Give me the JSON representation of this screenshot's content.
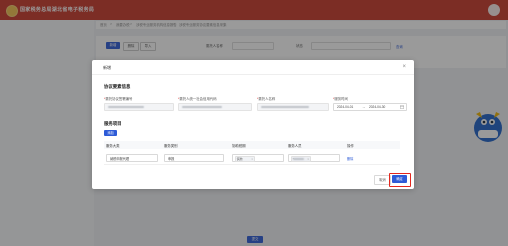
{
  "portal": {
    "title": "国家税务总局湖北省电子税务局"
  },
  "breadcrumb": {
    "home": "首页",
    "sep1": ">",
    "level1": "我要办税",
    "sep2": ">",
    "level2": "涉税专业服务机构信息报告",
    "sep3": ">",
    "current": "涉税专业服务协议要素信息采集"
  },
  "toolbar": {
    "add_label": "新增",
    "delete_label": "删除",
    "import_label": "导入"
  },
  "filters": {
    "client_label": "委托人名称",
    "status_label": "状态",
    "query_label": "查询"
  },
  "bottom": {
    "submit_label": "提交"
  },
  "modal": {
    "title": "新增",
    "close_label": "×",
    "section_agreement": "协议要素信息",
    "fields": {
      "agreement_no_label": "委托协议签署编号",
      "client_id_label": "委托人统一社会信用代码",
      "client_name_label": "委托人名称",
      "period_label": "服务时间",
      "required_mark": "*",
      "period_start": "2024-04-01",
      "period_sep": "→",
      "period_end": "2024-04-30"
    },
    "section_items": "服务项目",
    "add_item_label": "添加",
    "table": {
      "headers": [
        "服务大类",
        "服务类别",
        "协助税期",
        "服务人员",
        "操作"
      ],
      "rows": [
        {
          "category": "纳税申报代理",
          "subcategory": "申报",
          "tax_period": "其他",
          "staff": "",
          "action": "删除"
        }
      ]
    },
    "cancel_label": "取消",
    "confirm_label": "确定"
  },
  "colors": {
    "primary": "#2d5bd7",
    "header": "#c8392b",
    "highlight": "#e3261d"
  }
}
